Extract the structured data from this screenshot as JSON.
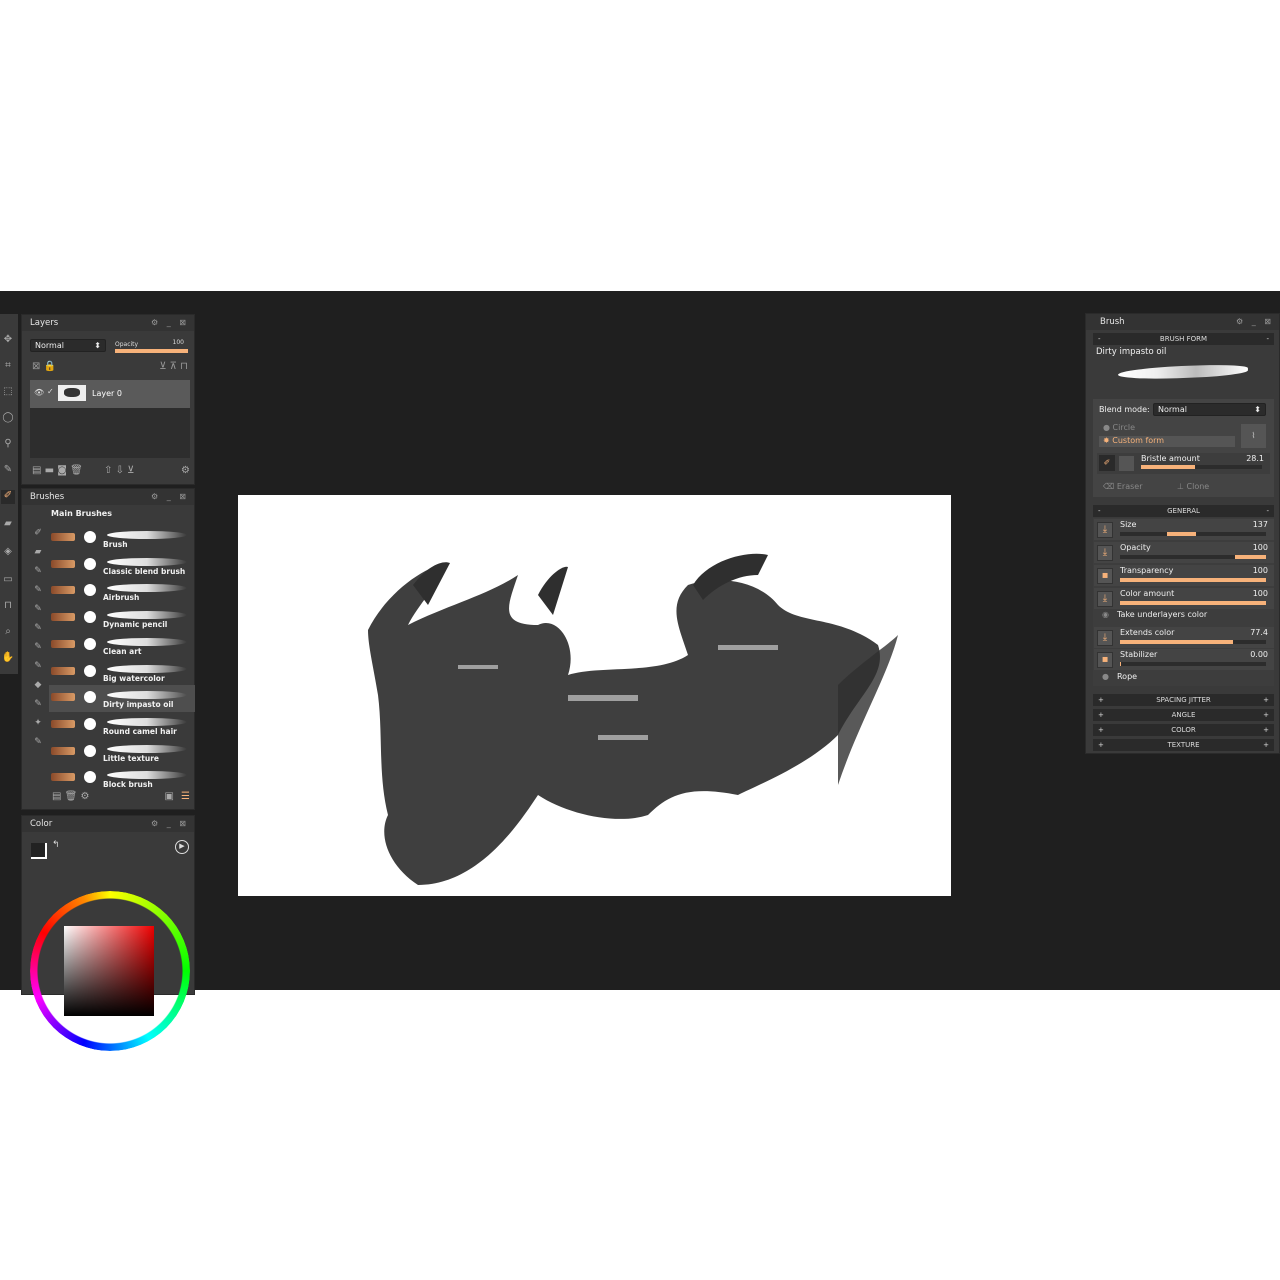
{
  "layers": {
    "title": "Layers",
    "blend": "Normal",
    "opacity_label": "Opacity",
    "opacity_value": "100",
    "opacity_pct": 100,
    "layer_name": "Layer 0"
  },
  "brushes": {
    "title": "Brushes",
    "group": "Main Brushes",
    "items": [
      {
        "label": "Brush"
      },
      {
        "label": "Classic blend brush"
      },
      {
        "label": "Airbrush"
      },
      {
        "label": "Dynamic pencil"
      },
      {
        "label": "Clean art"
      },
      {
        "label": "Big watercolor"
      },
      {
        "label": "Dirty impasto oil",
        "selected": true
      },
      {
        "label": "Round camel hair"
      },
      {
        "label": "Little texture"
      },
      {
        "label": "Block brush"
      }
    ]
  },
  "color": {
    "title": "Color"
  },
  "brush": {
    "title": "Brush",
    "form_section": "BRUSH FORM",
    "brush_name": "Dirty impasto oil",
    "blend_label": "Blend mode:",
    "blend_value": "Normal",
    "circle": "Circle",
    "custom_form": "Custom form",
    "bristle_label": "Bristle amount",
    "bristle_value": "28.1",
    "bristle_pct": 45,
    "eraser": "Eraser",
    "clone": "Clone",
    "general_section": "GENERAL",
    "params": [
      {
        "label": "Size",
        "value": "137",
        "from": 32,
        "to": 52
      },
      {
        "label": "Opacity",
        "value": "100",
        "from": 79,
        "to": 100
      },
      {
        "label": "Transparency",
        "value": "100",
        "from": 0,
        "to": 100
      },
      {
        "label": "Color amount",
        "value": "100",
        "from": 0,
        "to": 100
      },
      {
        "label": "Extends color",
        "value": "77.4",
        "from": 0,
        "to": 77.4
      },
      {
        "label": "Stabilizer",
        "value": "0.00",
        "from": 0,
        "to": 1
      }
    ],
    "take_underlayers": "Take underlayers color",
    "rope": "Rope",
    "collapsed": [
      "SPACING JITTER",
      "ANGLE",
      "COLOR",
      "TEXTURE"
    ]
  },
  "accent": "#f7b27a"
}
